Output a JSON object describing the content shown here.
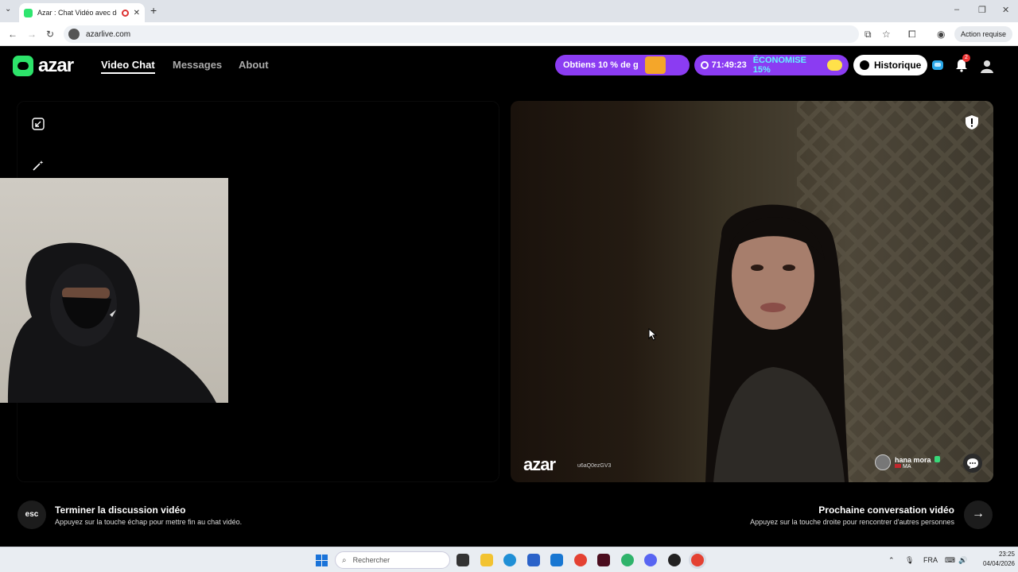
{
  "browser": {
    "tab_title": "Azar : Chat Vidéo avec de n",
    "url": "azarlive.com",
    "action_required": "Action requise",
    "new_tab": "+",
    "tab_close": "✕"
  },
  "header": {
    "logo_text": "azar",
    "nav": [
      {
        "label": "Video Chat",
        "active": true
      },
      {
        "label": "Messages",
        "active": false
      },
      {
        "label": "About",
        "active": false
      }
    ],
    "promo_offer": "Obtiens 10 % de g",
    "timer": "71:49:23",
    "timer_save": "ÉCONOMISE 15%",
    "history_label": "Historique",
    "notification_count": "2"
  },
  "video": {
    "watermark": "azar",
    "watermark_id": "u6aQ0ezGV3",
    "remote_user_name": "hana mora",
    "remote_user_country": "MA"
  },
  "footer": {
    "esc_key": "esc",
    "end_title": "Terminer la discussion vidéo",
    "end_sub": "Appuyez sur la touche échap pour mettre fin au chat vidéo.",
    "next_title": "Prochaine conversation vidéo",
    "next_sub": "Appuyez sur la touche droite pour rencontrer d'autres personnes",
    "next_arrow": "→"
  },
  "taskbar": {
    "search_placeholder": "Rechercher",
    "language": "FRA",
    "time": "23:25",
    "date": "04/04/2026"
  },
  "colors": {
    "brand_green": "#2de36a",
    "promo_purple": "#8b3cf2",
    "save_cyan": "#63f2ff"
  }
}
